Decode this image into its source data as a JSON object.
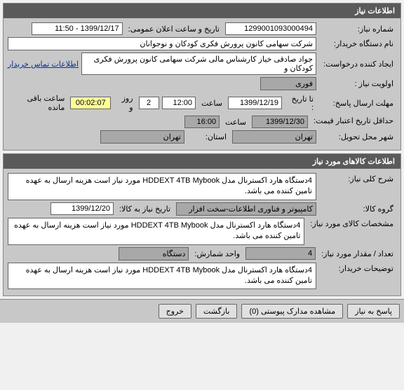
{
  "panel1": {
    "title": "اطلاعات نیاز",
    "need_number_label": "شماره نیاز:",
    "need_number": "1299001093000494",
    "announce_label": "تاریخ و ساعت اعلان عمومی:",
    "announce_value": "1399/12/17 - 11:50",
    "buyer_label": "نام دستگاه خریدار:",
    "buyer_value": "شرکت سهامی کانون پرورش فکری کودکان و نوجوانان",
    "creator_label": "ایجاد کننده درخواست:",
    "creator_value": "جواد صادقی خیاز کارشناس مالی شرکت سهامی کانون پرورش فکری کودکان و",
    "contact_link": "اطلاعات تماس خریدار",
    "priority_label": "اولویت نیاز :",
    "priority_value": "فوری",
    "deadline_label": "مهلت ارسال پاسخ:",
    "deadline_to_label": "تا تاریخ :",
    "deadline_date": "1399/12/19",
    "time_label": "ساعت",
    "deadline_time": "12:00",
    "days_remain": "2",
    "days_label": "روز و",
    "countdown": "00:02:07",
    "countdown_label": "ساعت باقی مانده",
    "validity_label": "حداقل تاریخ اعتبار قیمت:",
    "validity_date": "1399/12/30",
    "validity_time": "16:00",
    "delivery_city_label": "شهر محل تحویل:",
    "delivery_city": "تهران",
    "province_label": "استان:",
    "province": "تهران"
  },
  "panel2": {
    "title": "اطلاعات کالاهای مورد نیاز",
    "desc_label": "شرح کلی نیاز:",
    "desc_value": "4دستگاه هارد اکسترنال مدل HDDEXT 4TB Mybook مورد نیاز است هزینه ارسال به عهده تامین کننده می باشد.",
    "group_label": "گروه کالا:",
    "group_value": "کامپیوتر و فناوری اطلاعات-سخت افزار",
    "goods_date_label": "تاریخ نیاز به کالا:",
    "goods_date": "1399/12/20",
    "spec_label": "مشخصات کالای مورد نیاز:",
    "spec_value": "4دستگاه هارد اکسترنال مدل HDDEXT 4TB Mybook مورد نیاز است هزینه ارسال به عهده تامین کننده می باشد.",
    "qty_label": "تعداد / مقدار مورد نیاز:",
    "qty_value": "4",
    "unit_label": "واحد شمارش:",
    "unit_value": "دستگاه",
    "buyer_notes_label": "توضیحات خریدار:",
    "buyer_notes_value": "4دستگاه هارد اکسترنال مدل HDDEXT 4TB Mybook مورد نیاز است هزینه ارسال به عهده تامین کننده می باشد."
  },
  "buttons": {
    "respond": "پاسخ به نیاز",
    "attachments": "مشاهده مدارک پیوستی (0)",
    "back": "بازگشت",
    "exit": "خروج"
  }
}
